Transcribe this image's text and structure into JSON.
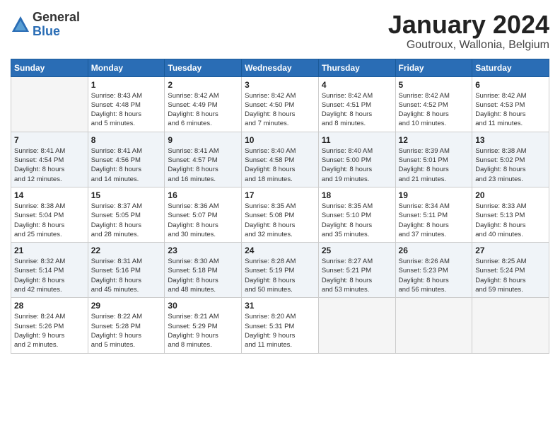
{
  "header": {
    "logo_general": "General",
    "logo_blue": "Blue",
    "month": "January 2024",
    "location": "Goutroux, Wallonia, Belgium"
  },
  "weekdays": [
    "Sunday",
    "Monday",
    "Tuesday",
    "Wednesday",
    "Thursday",
    "Friday",
    "Saturday"
  ],
  "weeks": [
    [
      {
        "day": "",
        "info": ""
      },
      {
        "day": "1",
        "info": "Sunrise: 8:43 AM\nSunset: 4:48 PM\nDaylight: 8 hours\nand 5 minutes."
      },
      {
        "day": "2",
        "info": "Sunrise: 8:42 AM\nSunset: 4:49 PM\nDaylight: 8 hours\nand 6 minutes."
      },
      {
        "day": "3",
        "info": "Sunrise: 8:42 AM\nSunset: 4:50 PM\nDaylight: 8 hours\nand 7 minutes."
      },
      {
        "day": "4",
        "info": "Sunrise: 8:42 AM\nSunset: 4:51 PM\nDaylight: 8 hours\nand 8 minutes."
      },
      {
        "day": "5",
        "info": "Sunrise: 8:42 AM\nSunset: 4:52 PM\nDaylight: 8 hours\nand 10 minutes."
      },
      {
        "day": "6",
        "info": "Sunrise: 8:42 AM\nSunset: 4:53 PM\nDaylight: 8 hours\nand 11 minutes."
      }
    ],
    [
      {
        "day": "7",
        "info": "Sunrise: 8:41 AM\nSunset: 4:54 PM\nDaylight: 8 hours\nand 12 minutes."
      },
      {
        "day": "8",
        "info": "Sunrise: 8:41 AM\nSunset: 4:56 PM\nDaylight: 8 hours\nand 14 minutes."
      },
      {
        "day": "9",
        "info": "Sunrise: 8:41 AM\nSunset: 4:57 PM\nDaylight: 8 hours\nand 16 minutes."
      },
      {
        "day": "10",
        "info": "Sunrise: 8:40 AM\nSunset: 4:58 PM\nDaylight: 8 hours\nand 18 minutes."
      },
      {
        "day": "11",
        "info": "Sunrise: 8:40 AM\nSunset: 5:00 PM\nDaylight: 8 hours\nand 19 minutes."
      },
      {
        "day": "12",
        "info": "Sunrise: 8:39 AM\nSunset: 5:01 PM\nDaylight: 8 hours\nand 21 minutes."
      },
      {
        "day": "13",
        "info": "Sunrise: 8:38 AM\nSunset: 5:02 PM\nDaylight: 8 hours\nand 23 minutes."
      }
    ],
    [
      {
        "day": "14",
        "info": "Sunrise: 8:38 AM\nSunset: 5:04 PM\nDaylight: 8 hours\nand 25 minutes."
      },
      {
        "day": "15",
        "info": "Sunrise: 8:37 AM\nSunset: 5:05 PM\nDaylight: 8 hours\nand 28 minutes."
      },
      {
        "day": "16",
        "info": "Sunrise: 8:36 AM\nSunset: 5:07 PM\nDaylight: 8 hours\nand 30 minutes."
      },
      {
        "day": "17",
        "info": "Sunrise: 8:35 AM\nSunset: 5:08 PM\nDaylight: 8 hours\nand 32 minutes."
      },
      {
        "day": "18",
        "info": "Sunrise: 8:35 AM\nSunset: 5:10 PM\nDaylight: 8 hours\nand 35 minutes."
      },
      {
        "day": "19",
        "info": "Sunrise: 8:34 AM\nSunset: 5:11 PM\nDaylight: 8 hours\nand 37 minutes."
      },
      {
        "day": "20",
        "info": "Sunrise: 8:33 AM\nSunset: 5:13 PM\nDaylight: 8 hours\nand 40 minutes."
      }
    ],
    [
      {
        "day": "21",
        "info": "Sunrise: 8:32 AM\nSunset: 5:14 PM\nDaylight: 8 hours\nand 42 minutes."
      },
      {
        "day": "22",
        "info": "Sunrise: 8:31 AM\nSunset: 5:16 PM\nDaylight: 8 hours\nand 45 minutes."
      },
      {
        "day": "23",
        "info": "Sunrise: 8:30 AM\nSunset: 5:18 PM\nDaylight: 8 hours\nand 48 minutes."
      },
      {
        "day": "24",
        "info": "Sunrise: 8:28 AM\nSunset: 5:19 PM\nDaylight: 8 hours\nand 50 minutes."
      },
      {
        "day": "25",
        "info": "Sunrise: 8:27 AM\nSunset: 5:21 PM\nDaylight: 8 hours\nand 53 minutes."
      },
      {
        "day": "26",
        "info": "Sunrise: 8:26 AM\nSunset: 5:23 PM\nDaylight: 8 hours\nand 56 minutes."
      },
      {
        "day": "27",
        "info": "Sunrise: 8:25 AM\nSunset: 5:24 PM\nDaylight: 8 hours\nand 59 minutes."
      }
    ],
    [
      {
        "day": "28",
        "info": "Sunrise: 8:24 AM\nSunset: 5:26 PM\nDaylight: 9 hours\nand 2 minutes."
      },
      {
        "day": "29",
        "info": "Sunrise: 8:22 AM\nSunset: 5:28 PM\nDaylight: 9 hours\nand 5 minutes."
      },
      {
        "day": "30",
        "info": "Sunrise: 8:21 AM\nSunset: 5:29 PM\nDaylight: 9 hours\nand 8 minutes."
      },
      {
        "day": "31",
        "info": "Sunrise: 8:20 AM\nSunset: 5:31 PM\nDaylight: 9 hours\nand 11 minutes."
      },
      {
        "day": "",
        "info": ""
      },
      {
        "day": "",
        "info": ""
      },
      {
        "day": "",
        "info": ""
      }
    ]
  ]
}
